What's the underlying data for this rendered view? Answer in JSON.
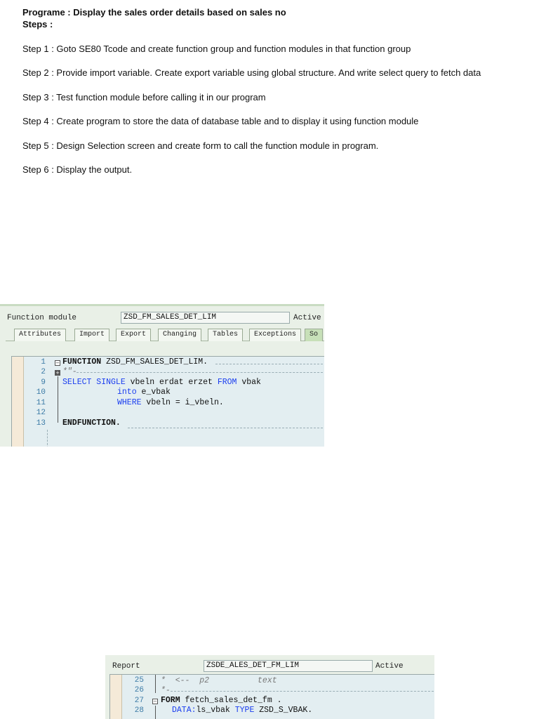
{
  "document": {
    "title": "Programe : Display the sales order details based on sales no",
    "steps_heading": "Steps :",
    "steps": [
      "Step 1 :  Goto SE80 Tcode and create function group and function modules in that function group",
      "Step 2 : Provide import variable. Create export variable using global structure. And write select query to fetch data",
      "Step 3 : Test function module before calling it in our program",
      " Step 4 : Create program to store the data of database table and to display it using function module",
      "Step 5 : Design Selection screen and create form to call the function module in program.",
      "Step 6 : Display the output."
    ]
  },
  "screenshot1": {
    "object_label": "Function module",
    "object_name": "ZSD_FM_SALES_DET_LIM",
    "status": "Active",
    "tabs": [
      "Attributes",
      "Import",
      "Export",
      "Changing",
      "Tables",
      "Exceptions",
      "So"
    ],
    "active_tab_index": 6,
    "line_numbers": [
      "1",
      "2",
      "9",
      "10",
      "11",
      "12",
      "13"
    ],
    "code": {
      "l1_kw": "FUNCTION",
      "l1_rest": " ZSD_FM_SALES_DET_LIM.",
      "l2_comment": "*\"-",
      "l9_kw1": "SELECT SINGLE",
      "l9_mid": " vbeln erdat erzet ",
      "l9_kw2": "FROM",
      "l9_rest": " vbak",
      "l10_kw": "into",
      "l10_rest": " e_vbak",
      "l11_kw": "WHERE",
      "l11_rest": " vbeln = i_vbeln.",
      "l13_kw": "ENDFUNCTION."
    }
  },
  "screenshot2": {
    "object_label": "Report",
    "object_name": "ZSDE_ALES_DET_FM_LIM",
    "status": "Active",
    "line_numbers": [
      "25",
      "26",
      "27",
      "28"
    ],
    "code": {
      "l25_comment": "*  <--  p2          text",
      "l26_comment": "*-",
      "l27_kw": "FORM",
      "l27_rest": " fetch_sales_det_fm .",
      "l28_kw1": "DATA:",
      "l28_mid": "ls_vbak ",
      "l28_kw2": "TYPE",
      "l28_rest": " ZSD_S_VBAK."
    }
  }
}
